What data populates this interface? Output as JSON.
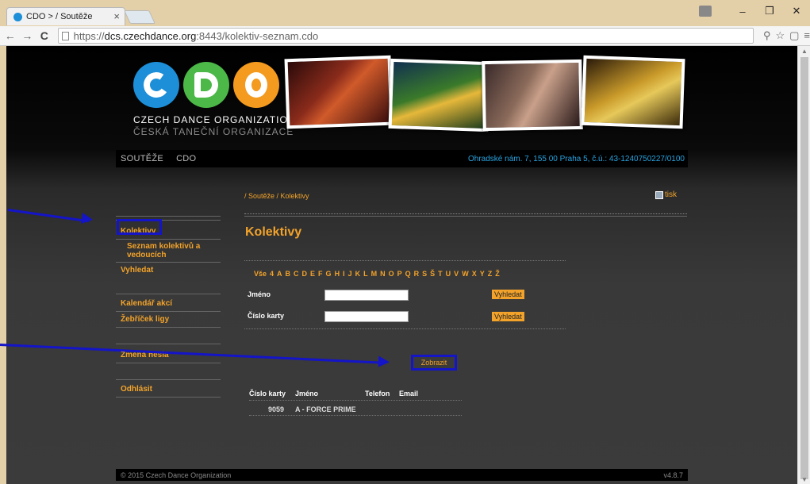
{
  "browser": {
    "tab_title": "CDO > / Soutěže",
    "tab_close": "×",
    "url_proto": "https://",
    "url_host": "dcs.czechdance.org",
    "url_path": ":8443/kolektiv-seznam.cdo",
    "nav_back": "←",
    "nav_forward": "→",
    "nav_reload": "C",
    "win_minimize": "–",
    "win_restore": "❐",
    "win_close": "✕",
    "toolbar_icons": [
      "⚲",
      "☆",
      "▢",
      "≡"
    ]
  },
  "header": {
    "logo_line1": "CZECH DANCE ORGANIZATION",
    "logo_line2": "ČESKÁ TANEČNÍ ORGANIZACE",
    "nav": [
      "SOUTĚŽE",
      "CDO"
    ],
    "address": "Ohradské nám. 7, 155 00 Praha 5, č.ú.: 43-1240750227/0100"
  },
  "sidebar": {
    "items": [
      {
        "label": "Kolektivy"
      },
      {
        "label": "Seznam kolektivů a vedoucích"
      },
      {
        "label": "Vyhledat"
      },
      {
        "label": "Kalendář akcí"
      },
      {
        "label": "Žebříček ligy"
      },
      {
        "label": "Změna hesla"
      },
      {
        "label": "Odhlásit"
      }
    ]
  },
  "main": {
    "breadcrumb": "/ Soutěže / Kolektivy",
    "print_label": "tisk",
    "title": "Kolektivy",
    "alphabet": [
      "Vše",
      "4",
      "A",
      "B",
      "C",
      "D",
      "E",
      "F",
      "G",
      "H",
      "I",
      "J",
      "K",
      "L",
      "M",
      "N",
      "O",
      "P",
      "Q",
      "R",
      "S",
      "Š",
      "T",
      "U",
      "V",
      "W",
      "X",
      "Y",
      "Z",
      "Ž"
    ],
    "form": {
      "name_label": "Jméno",
      "card_label": "Číslo karty",
      "search_button": "Vyhledat"
    },
    "table": {
      "headers": [
        "Číslo karty",
        "Jméno",
        "Telefon",
        "Email"
      ],
      "rows": [
        {
          "card": "9059",
          "name": "A - FORCE PRIME",
          "phone": "",
          "email": "",
          "action": "Zobrazit"
        }
      ]
    }
  },
  "footer": {
    "copyright": "© 2015 Czech Dance Organization",
    "version": "v4.8.7"
  },
  "colors": {
    "accent": "#f3a32a",
    "link_blue": "#29a3e0",
    "annotation": "#1414c8"
  }
}
